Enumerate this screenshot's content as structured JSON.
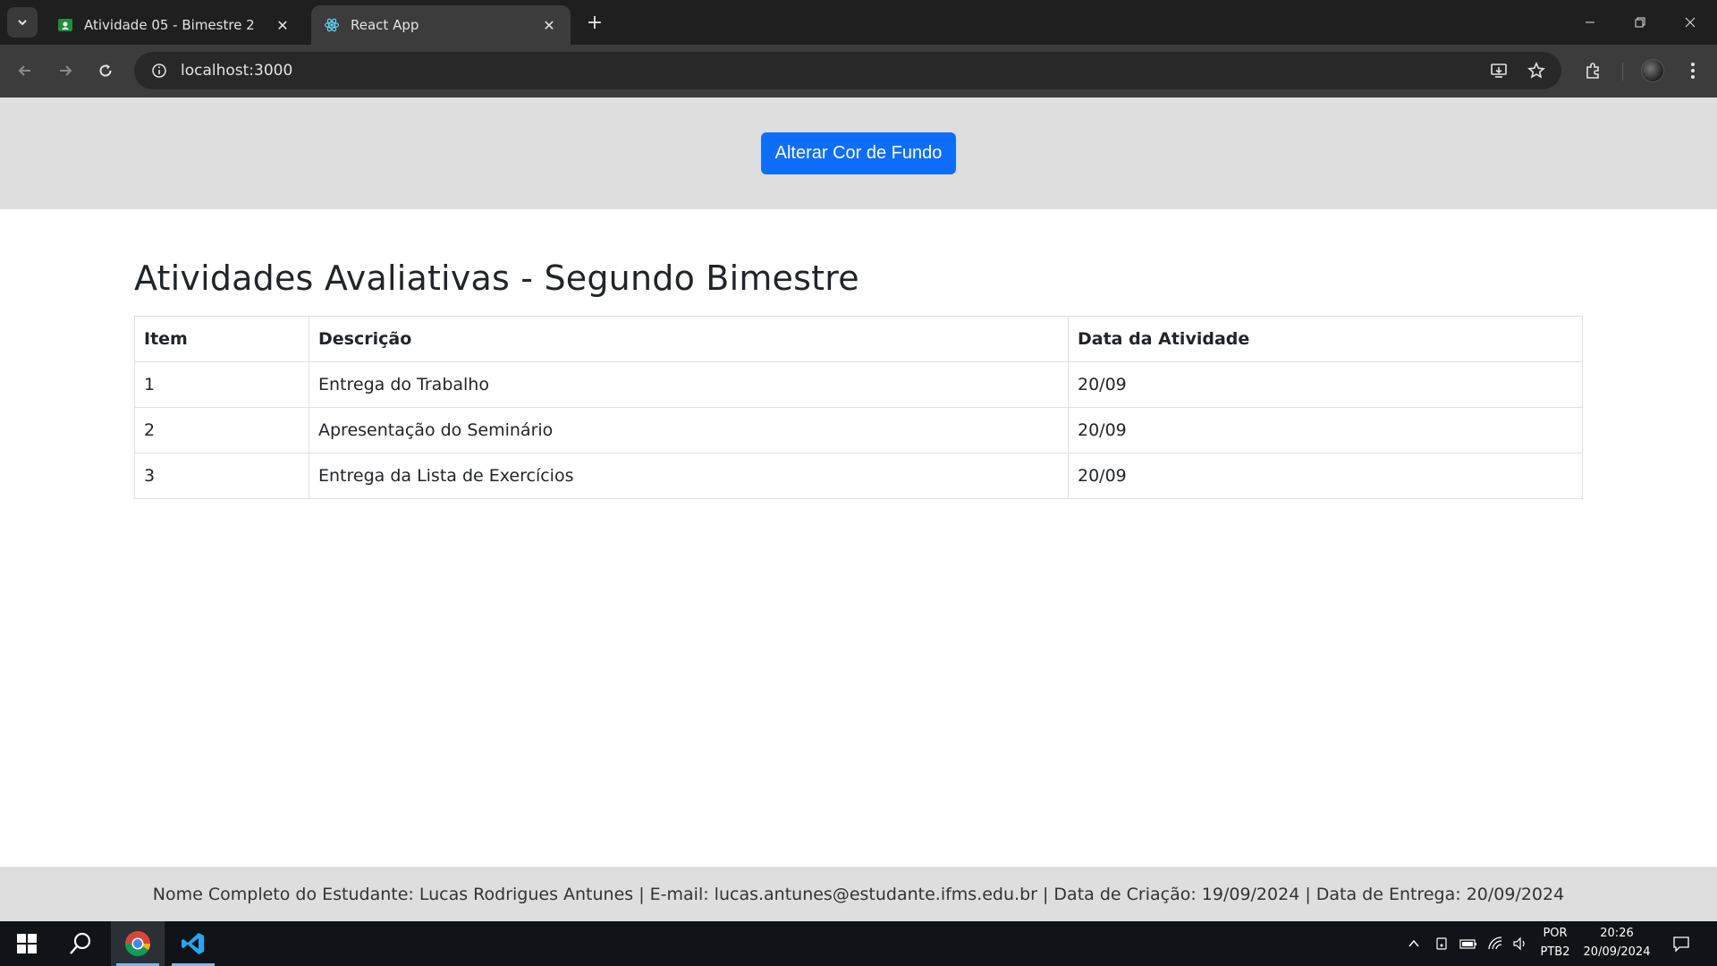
{
  "browser": {
    "tabs": [
      {
        "title": "Atividade 05 - Bimestre 2",
        "favicon": "google-classroom-icon"
      },
      {
        "title": "React App",
        "favicon": "react-icon"
      }
    ],
    "url": "localhost:3000"
  },
  "page": {
    "button_label": "Alterar Cor de Fundo",
    "title": "Atividades Avaliativas - Segundo Bimestre",
    "table": {
      "headers": [
        "Item",
        "Descrição",
        "Data da Atividade"
      ],
      "rows": [
        [
          "1",
          "Entrega do Trabalho",
          "20/09"
        ],
        [
          "2",
          "Apresentação do Seminário",
          "20/09"
        ],
        [
          "3",
          "Entrega da Lista de Exercícios",
          "20/09"
        ]
      ]
    },
    "footer": "Nome Completo do Estudante: Lucas Rodrigues Antunes | E-mail: lucas.antunes@estudante.ifms.edu.br | Data de Criação: 19/09/2024 | Data de Entrega: 20/09/2024"
  },
  "taskbar": {
    "language": "POR",
    "layout": "PTB2",
    "time": "20:26",
    "date": "20/09/2024"
  },
  "colors": {
    "primary_button": "#0d6efd",
    "header_bg": "#dedede",
    "footer_bg": "#dedede"
  }
}
